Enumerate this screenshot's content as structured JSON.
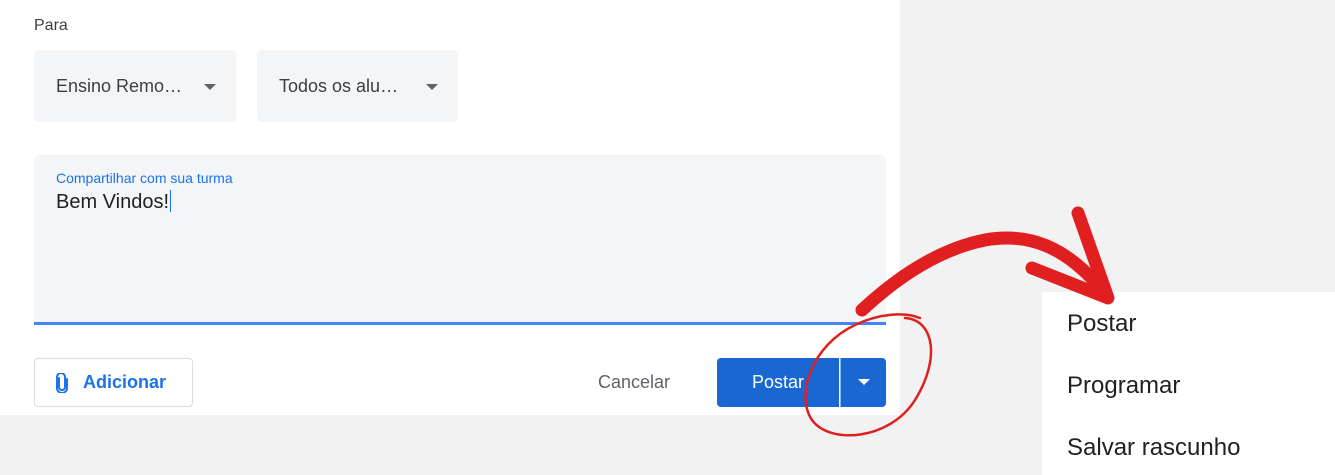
{
  "post_form": {
    "to_label": "Para",
    "class_select": {
      "value": "Ensino Remo…"
    },
    "students_select": {
      "value": "Todos os alu…"
    },
    "composer": {
      "label": "Compartilhar com sua turma",
      "value": "Bem Vindos!"
    },
    "add_button": {
      "label": "Adicionar",
      "icon": "paperclip-icon"
    },
    "cancel_button": {
      "label": "Cancelar"
    },
    "post_button": {
      "label": "Postar"
    },
    "post_options_button": {
      "icon": "chevron-down-icon"
    }
  },
  "post_menu": {
    "items": [
      {
        "label": "Postar"
      },
      {
        "label": "Programar"
      },
      {
        "label": "Salvar rascunho"
      }
    ]
  },
  "colors": {
    "accent": "#1a73e8",
    "primary_button": "#1967d2",
    "annotation": "#e02020"
  }
}
